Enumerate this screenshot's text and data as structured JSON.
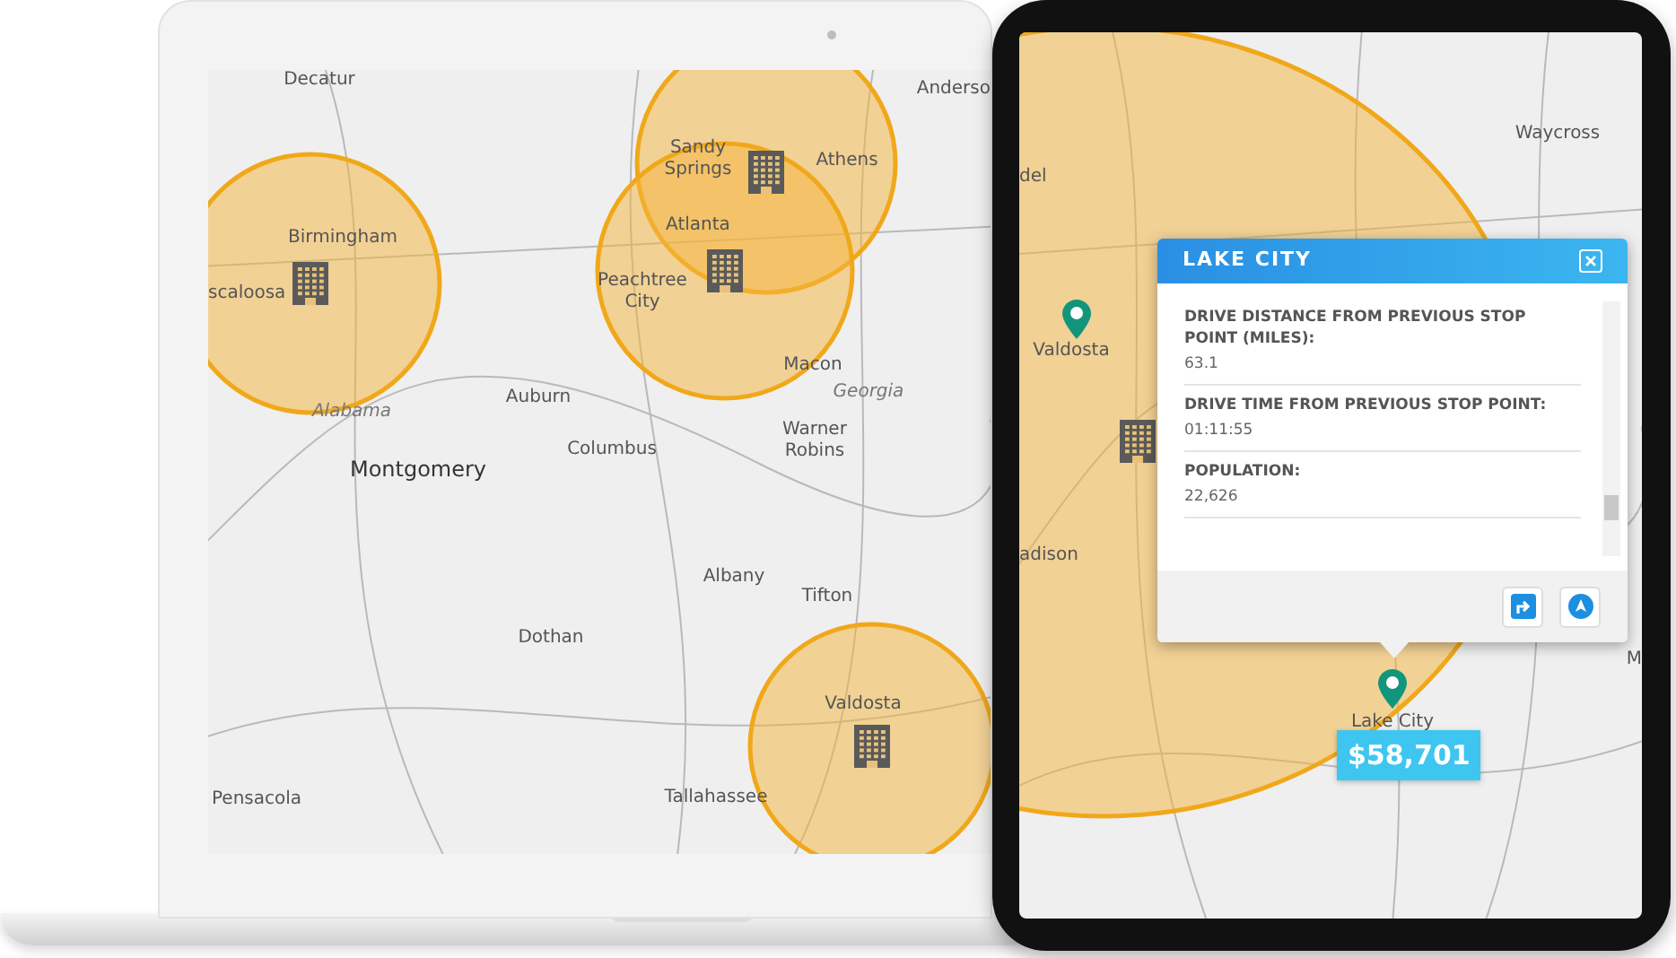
{
  "laptop": {
    "map": {
      "labels": [
        {
          "text": "Decatur",
          "kind": "city"
        },
        {
          "text": "Anderso",
          "kind": "city"
        },
        {
          "text": "Sandy Springs",
          "kind": "city"
        },
        {
          "text": "Athens",
          "kind": "city"
        },
        {
          "text": "Birmingham",
          "kind": "city"
        },
        {
          "text": "scaloosa",
          "kind": "city"
        },
        {
          "text": "Atlanta",
          "kind": "city"
        },
        {
          "text": "Peachtree City",
          "kind": "city"
        },
        {
          "text": "Macon",
          "kind": "city"
        },
        {
          "text": "Georgia",
          "kind": "state"
        },
        {
          "text": "Alabama",
          "kind": "state"
        },
        {
          "text": "Auburn",
          "kind": "city"
        },
        {
          "text": "Columbus",
          "kind": "city"
        },
        {
          "text": "Warner Robins",
          "kind": "city"
        },
        {
          "text": "Montgomery",
          "kind": "capital"
        },
        {
          "text": "Albany",
          "kind": "city"
        },
        {
          "text": "Tifton",
          "kind": "city"
        },
        {
          "text": "Dothan",
          "kind": "city"
        },
        {
          "text": "Valdosta",
          "kind": "city"
        },
        {
          "text": "Pensacola",
          "kind": "city"
        },
        {
          "text": "Tallahassee",
          "kind": "city"
        }
      ]
    }
  },
  "tablet": {
    "map": {
      "labels": [
        {
          "text": "del",
          "kind": "city"
        },
        {
          "text": "Waycross",
          "kind": "city"
        },
        {
          "text": "Valdosta",
          "kind": "city"
        },
        {
          "text": "adison",
          "kind": "city"
        },
        {
          "text": "M",
          "kind": "city"
        },
        {
          "text": "Lake City",
          "kind": "city"
        }
      ]
    },
    "popup": {
      "title": "LAKE CITY",
      "fields": [
        {
          "label": "DRIVE DISTANCE FROM PREVIOUS STOP POINT (MILES):",
          "value": "63.1"
        },
        {
          "label": "DRIVE TIME FROM PREVIOUS STOP POINT:",
          "value": "01:11:55"
        },
        {
          "label": "POPULATION:",
          "value": "22,626"
        }
      ]
    },
    "price_tag": "$58,701"
  }
}
